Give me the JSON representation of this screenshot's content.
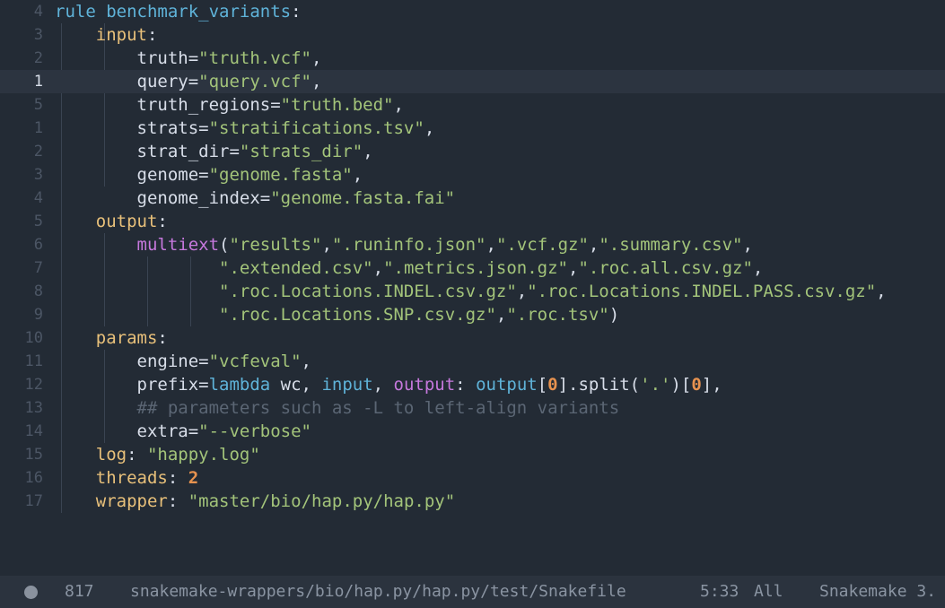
{
  "editor": {
    "current_line_index": 3,
    "lines": [
      {
        "num": "4",
        "tokens": [
          [
            "kw",
            "rule "
          ],
          [
            "def",
            "benchmark_variants"
          ],
          [
            "pl",
            ":"
          ]
        ]
      },
      {
        "num": "3",
        "tokens": [
          [
            "pl",
            "    "
          ],
          [
            "sec",
            "input"
          ],
          [
            "pl",
            ":"
          ]
        ]
      },
      {
        "num": "2",
        "tokens": [
          [
            "pl",
            "        truth="
          ],
          [
            "str",
            "\"truth.vcf\""
          ],
          [
            "pl",
            ","
          ]
        ]
      },
      {
        "num": "1",
        "tokens": [
          [
            "pl",
            "        query="
          ],
          [
            "str",
            "\"query.vcf\""
          ],
          [
            "pl",
            ","
          ]
        ]
      },
      {
        "num": "5",
        "tokens": [
          [
            "pl",
            "        truth_regions="
          ],
          [
            "str",
            "\"truth.bed\""
          ],
          [
            "pl",
            ","
          ]
        ]
      },
      {
        "num": "1",
        "tokens": [
          [
            "pl",
            "        strats="
          ],
          [
            "str",
            "\"stratifications.tsv\""
          ],
          [
            "pl",
            ","
          ]
        ]
      },
      {
        "num": "2",
        "tokens": [
          [
            "pl",
            "        strat_dir="
          ],
          [
            "str",
            "\"strats_dir\""
          ],
          [
            "pl",
            ","
          ]
        ]
      },
      {
        "num": "3",
        "tokens": [
          [
            "pl",
            "        genome="
          ],
          [
            "str",
            "\"genome.fasta\""
          ],
          [
            "pl",
            ","
          ]
        ]
      },
      {
        "num": "4",
        "tokens": [
          [
            "pl",
            "        genome_index="
          ],
          [
            "str",
            "\"genome.fasta.fai\""
          ]
        ]
      },
      {
        "num": "5",
        "tokens": [
          [
            "pl",
            "    "
          ],
          [
            "sec",
            "output"
          ],
          [
            "pl",
            ":"
          ]
        ]
      },
      {
        "num": "6",
        "tokens": [
          [
            "pl",
            "        "
          ],
          [
            "fn",
            "multiext"
          ],
          [
            "pl",
            "("
          ],
          [
            "str",
            "\"results\""
          ],
          [
            "pl",
            ","
          ],
          [
            "str",
            "\".runinfo.json\""
          ],
          [
            "pl",
            ","
          ],
          [
            "str",
            "\".vcf.gz\""
          ],
          [
            "pl",
            ","
          ],
          [
            "str",
            "\".summary.csv\""
          ],
          [
            "pl",
            ","
          ]
        ]
      },
      {
        "num": "7",
        "tokens": [
          [
            "pl",
            "                "
          ],
          [
            "str",
            "\".extended.csv\""
          ],
          [
            "pl",
            ","
          ],
          [
            "str",
            "\".metrics.json.gz\""
          ],
          [
            "pl",
            ","
          ],
          [
            "str",
            "\".roc.all.csv.gz\""
          ],
          [
            "pl",
            ","
          ]
        ]
      },
      {
        "num": "8",
        "tokens": [
          [
            "pl",
            "                "
          ],
          [
            "str",
            "\".roc.Locations.INDEL.csv.gz\""
          ],
          [
            "pl",
            ","
          ],
          [
            "str",
            "\".roc.Locations.INDEL.PASS.csv.gz\""
          ],
          [
            "pl",
            ","
          ]
        ]
      },
      {
        "num": "9",
        "tokens": [
          [
            "pl",
            "                "
          ],
          [
            "str",
            "\".roc.Locations.SNP.csv.gz\""
          ],
          [
            "pl",
            ","
          ],
          [
            "str",
            "\".roc.tsv\""
          ],
          [
            "pl",
            ")"
          ]
        ]
      },
      {
        "num": "10",
        "tokens": [
          [
            "pl",
            "    "
          ],
          [
            "sec",
            "params"
          ],
          [
            "pl",
            ":"
          ]
        ]
      },
      {
        "num": "11",
        "tokens": [
          [
            "pl",
            "        engine="
          ],
          [
            "str",
            "\"vcfeval\""
          ],
          [
            "pl",
            ","
          ]
        ]
      },
      {
        "num": "12",
        "tokens": [
          [
            "pl",
            "        prefix="
          ],
          [
            "kw",
            "lambda"
          ],
          [
            "pl",
            " wc, "
          ],
          [
            "kw",
            "input"
          ],
          [
            "pl",
            ", "
          ],
          [
            "fn",
            "output"
          ],
          [
            "pl",
            ": "
          ],
          [
            "kw",
            "output"
          ],
          [
            "pl",
            "["
          ],
          [
            "num",
            "0"
          ],
          [
            "pl",
            "].split("
          ],
          [
            "str",
            "'.'"
          ],
          [
            "pl",
            ")["
          ],
          [
            "num",
            "0"
          ],
          [
            "pl",
            "],"
          ]
        ]
      },
      {
        "num": "13",
        "tokens": [
          [
            "pl",
            "        "
          ],
          [
            "cm",
            "## parameters such as -L to left-align variants"
          ]
        ]
      },
      {
        "num": "14",
        "tokens": [
          [
            "pl",
            "        extra="
          ],
          [
            "str",
            "\"--verbose\""
          ]
        ]
      },
      {
        "num": "15",
        "tokens": [
          [
            "pl",
            "    "
          ],
          [
            "sec",
            "log"
          ],
          [
            "pl",
            ": "
          ],
          [
            "str",
            "\"happy.log\""
          ]
        ]
      },
      {
        "num": "16",
        "tokens": [
          [
            "pl",
            "    "
          ],
          [
            "sec",
            "threads"
          ],
          [
            "pl",
            ": "
          ],
          [
            "num",
            "2"
          ]
        ]
      },
      {
        "num": "17",
        "tokens": [
          [
            "pl",
            "    "
          ],
          [
            "sec",
            "wrapper"
          ],
          [
            "pl",
            ": "
          ],
          [
            "str",
            "\"master/bio/hap.py/hap.py\""
          ]
        ]
      }
    ]
  },
  "statusbar": {
    "line_count": "817",
    "file_path": "snakemake-wrappers/bio/hap.py/hap.py/test/Snakefile",
    "cursor_position": "5:33",
    "scroll_position": "All",
    "language": "Snakemake 3."
  }
}
